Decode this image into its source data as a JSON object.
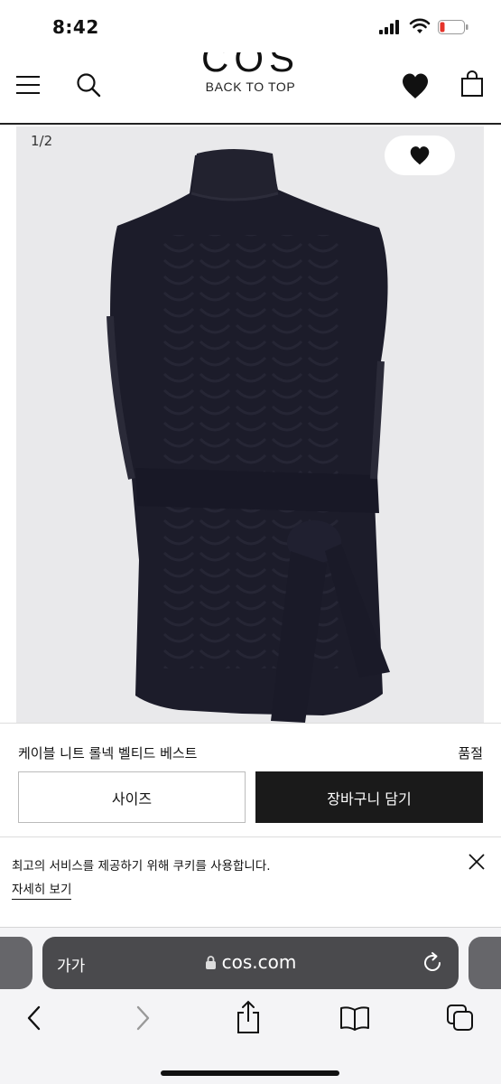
{
  "status_bar": {
    "time": "8:42"
  },
  "header": {
    "logo": "COS",
    "back_to_top": "BACK TO TOP"
  },
  "product": {
    "image_counter": "1/2",
    "name": "케이블 니트 롤넥 벨티드 베스트",
    "stock_status": "품절",
    "size_button": "사이즈",
    "cart_button": "장바구니 담기"
  },
  "cookie": {
    "text": "최고의 서비스를 제공하기 위해 쿠키를 사용합니다.",
    "link": "자세히 보기"
  },
  "browser": {
    "aa_label": "가가",
    "url": "cos.com"
  },
  "icons": {
    "menu": "menu-icon",
    "search": "search-icon",
    "wishlist": "heart-icon",
    "bag": "shopping-bag-icon",
    "close": "close-icon",
    "lock": "lock-icon",
    "reload": "reload-icon",
    "back": "chevron-left-icon",
    "forward": "chevron-right-icon",
    "share": "share-icon",
    "bookmarks": "book-icon",
    "tabs": "tabs-icon"
  },
  "colors": {
    "battery_low": "#e5332a",
    "cart_button_bg": "#1a1a1a",
    "image_bg": "#e9e9eb",
    "vest": "#1c1c2a"
  }
}
